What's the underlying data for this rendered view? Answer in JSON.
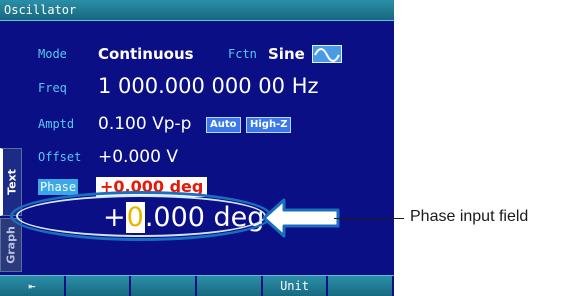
{
  "titlebar": {
    "title": "Oscillator"
  },
  "tabs": {
    "text": "Text",
    "graph": "Graph"
  },
  "params": {
    "mode": {
      "label": "Mode",
      "value": "Continuous"
    },
    "fctn": {
      "label": "Fctn",
      "value": "Sine",
      "icon": "sine-wave-icon"
    },
    "freq": {
      "label": "Freq",
      "value": "1 000.000 000 00 Hz"
    },
    "amptd": {
      "label": "Amptd",
      "value": "0.100 Vp-p",
      "badges": [
        "Auto",
        "High-Z"
      ]
    },
    "offset": {
      "label": "Offset",
      "value": "+0.000 V"
    },
    "phase": {
      "label": "Phase",
      "value": "+0.000 deg"
    }
  },
  "input": {
    "sign": "+",
    "cursor_digit": "0",
    "rest": ".000 deg"
  },
  "softkeys": [
    "⇤",
    "",
    "",
    "",
    "Unit",
    ""
  ],
  "annotation": {
    "callout": "Phase input field"
  },
  "colors": {
    "screen_bg": "#0b0f86",
    "label": "#58c8f0",
    "accent": "#3aa8e8",
    "highlight_text": "#e81808",
    "annotation_line": "#1a6ec2"
  }
}
